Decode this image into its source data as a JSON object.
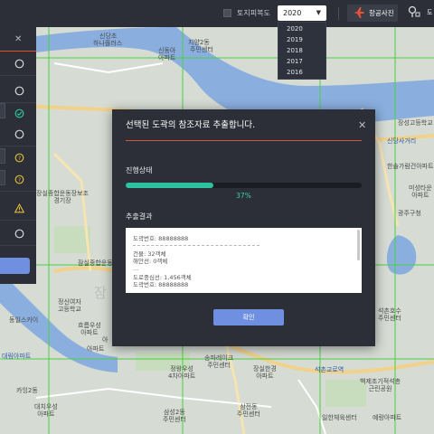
{
  "topbar": {
    "cadastral_label": "토지피복도",
    "year_selected": "2020",
    "year_options": [
      "2020",
      "2019",
      "2018",
      "2017",
      "2016"
    ],
    "aerial_label": "항공사진",
    "edge_label": "도"
  },
  "map_labels": [
    "신당초",
    "하나플러스",
    "지양2동",
    "주민센터",
    "신동아\n아파트",
    "장성고등학교",
    "신당사거리",
    "한솔가람건아파트",
    "미성타운\n아파트",
    "광주구청",
    "장실종합운동장보조\n경기장",
    "잠실종합운동장",
    "정신여자\n고등학교",
    "잠",
    "동일스카이",
    "흐름우성\n아파트",
    "대림아파트",
    "송파레이크\n주민센터",
    "정왕우성\n4차아파트",
    "장실한경\n아파트",
    "석촌교로역",
    "백제초기적석총\n근린공원",
    "석촌호수\n주민센터",
    "대치우성\n아파트",
    "삼전동\n주민센터",
    "일한체육센터",
    "삼성2동\n주민센터",
    "예랑아파트",
    "아",
    "아파트",
    "카잉2동"
  ],
  "left_panel": {
    "close_icon": "close-icon",
    "rows": [
      {
        "icon": "radio-icon"
      },
      {
        "icon": "radio-icon"
      },
      {
        "icon": "check-circle-icon"
      },
      {
        "icon": "radio-icon"
      },
      {
        "icon": "help-icon"
      },
      {
        "icon": "help-icon"
      },
      {
        "icon": "warning-icon"
      },
      {
        "icon": "radio-icon"
      }
    ]
  },
  "modal": {
    "title": "선택된 도곽의 참조자료 추출합니다.",
    "progress_label": "진행상태",
    "progress_value": 0.37,
    "progress_text": "37%",
    "result_label": "추출결과",
    "result_lines": [
      "도곽번호: 88888888",
      "건물: 32객체",
      "해안선: 0객체",
      "...",
      "도로중심선: 1,456객체",
      "도곽번호: 88888888"
    ],
    "confirm_label": "확인"
  },
  "colors": {
    "panel_bg": "#2c2f38",
    "accent_red": "#e0502f",
    "progress_green": "#2ec3a0",
    "button_blue": "#6f8fe0",
    "river": "#7fa2d8",
    "grid_line": "#49d13f"
  }
}
